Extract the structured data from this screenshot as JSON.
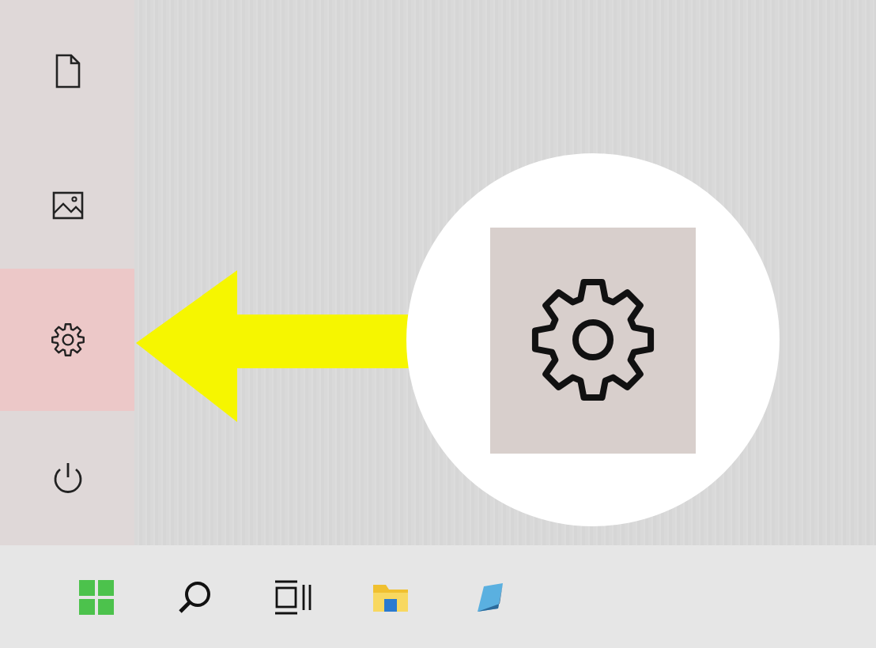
{
  "start_menu": {
    "items": [
      {
        "kind": "document",
        "highlighted": false
      },
      {
        "kind": "pictures",
        "highlighted": false
      },
      {
        "kind": "settings",
        "highlighted": true
      },
      {
        "kind": "power",
        "highlighted": false
      }
    ]
  },
  "callout": {
    "kind": "settings"
  },
  "taskbar": {
    "items": [
      {
        "kind": "start"
      },
      {
        "kind": "search"
      },
      {
        "kind": "task-view"
      },
      {
        "kind": "file-explorer"
      },
      {
        "kind": "app"
      }
    ]
  }
}
